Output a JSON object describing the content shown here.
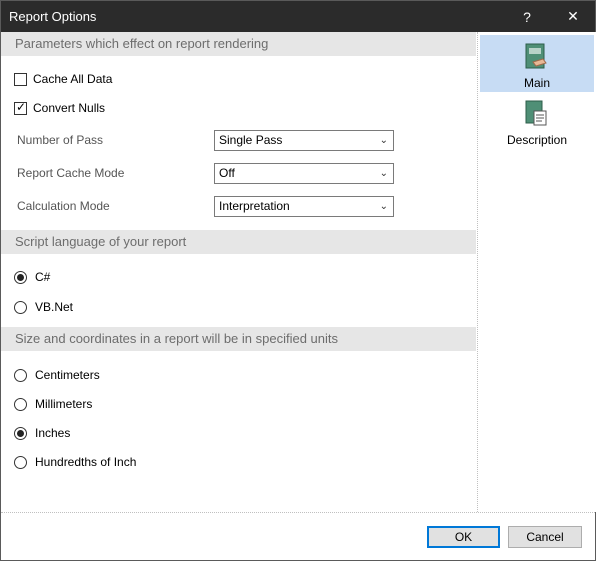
{
  "window": {
    "title": "Report Options",
    "help_glyph": "?",
    "close_glyph": "✕"
  },
  "sections": {
    "rendering": "Parameters which effect on report rendering",
    "script": "Script language of your report",
    "units": "Size and coordinates in a report will be in specified units"
  },
  "options": {
    "cache_all_data": {
      "label": "Cache All Data",
      "checked": false
    },
    "convert_nulls": {
      "label": "Convert Nulls",
      "checked": true
    }
  },
  "fields": {
    "number_of_pass": {
      "label": "Number of Pass",
      "value": "Single Pass"
    },
    "report_cache_mode": {
      "label": "Report Cache Mode",
      "value": "Off"
    },
    "calculation_mode": {
      "label": "Calculation Mode",
      "value": "Interpretation"
    }
  },
  "script_language": {
    "options": [
      "C#",
      "VB.Net"
    ],
    "selected": "C#"
  },
  "units": {
    "options": [
      "Centimeters",
      "Millimeters",
      "Inches",
      "Hundredths of Inch"
    ],
    "selected": "Inches"
  },
  "sidebar": {
    "items": [
      {
        "label": "Main",
        "icon": "main-page-icon",
        "active": true
      },
      {
        "label": "Description",
        "icon": "description-page-icon",
        "active": false
      }
    ]
  },
  "buttons": {
    "ok": "OK",
    "cancel": "Cancel"
  },
  "colors": {
    "accent": "#0078d7",
    "active_side": "#c7dcf4",
    "titlebar": "#2b2b2b"
  }
}
